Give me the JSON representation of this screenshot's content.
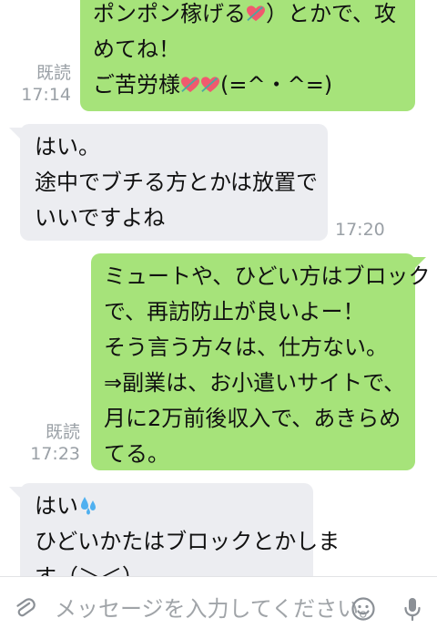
{
  "messages": [
    {
      "lines": [
        "ポンポン稼げる",
        "めてね！",
        "ご苦労様"
      ],
      "line1_suffix": "）とかで、攻",
      "line3_suffix": "(=^・^=)",
      "read_label": "既読",
      "time": "17:14"
    },
    {
      "lines": [
        "はい。",
        "途中でブチる方とかは放置で",
        "いいですよね"
      ],
      "time": "17:20"
    },
    {
      "lines": [
        "ミュートや、ひどい方はブロック",
        "で、再訪防止が良いよー！",
        "そう言う方々は、仕方ない。",
        "⇒副業は、お小遣いサイトで、",
        "月に2万前後収入で、あきらめ",
        "てる。"
      ],
      "read_label": "既読",
      "time": "17:23"
    },
    {
      "lines": [
        "はい",
        "ひどいかたはブロックとかしま",
        "す（＞＜）"
      ]
    }
  ],
  "input_bar": {
    "placeholder": "メッセージを入力してください。",
    "icons": [
      "paperclip-icon",
      "emoji-icon",
      "microphone-icon"
    ]
  },
  "colors": {
    "outgoing_bubble": "#a6e37a",
    "incoming_bubble": "#ecedf1",
    "meta_text": "#9aa0a6"
  }
}
